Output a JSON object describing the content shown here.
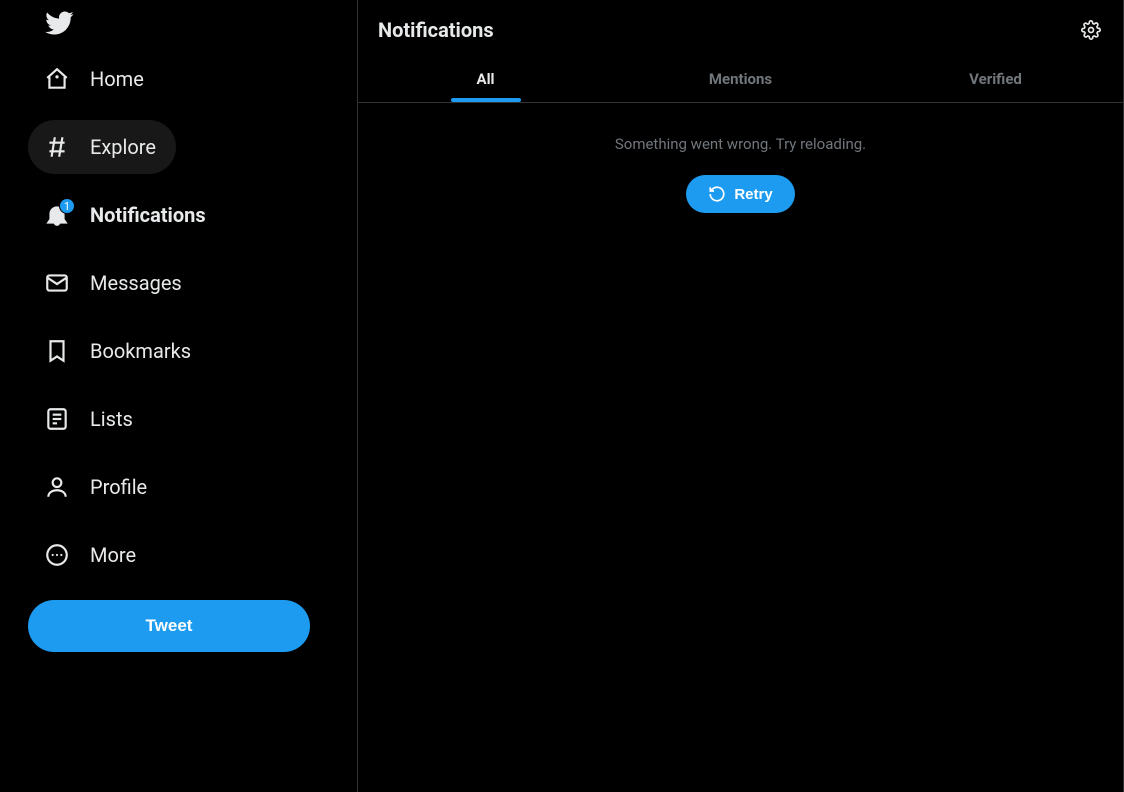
{
  "sidebar": {
    "tweet_label": "Tweet",
    "items": [
      {
        "key": "home",
        "label": "Home",
        "hovered": false,
        "active": false,
        "badge": null
      },
      {
        "key": "explore",
        "label": "Explore",
        "hovered": true,
        "active": false,
        "badge": null
      },
      {
        "key": "notifications",
        "label": "Notifications",
        "hovered": false,
        "active": true,
        "badge": "1"
      },
      {
        "key": "messages",
        "label": "Messages",
        "hovered": false,
        "active": false,
        "badge": null
      },
      {
        "key": "bookmarks",
        "label": "Bookmarks",
        "hovered": false,
        "active": false,
        "badge": null
      },
      {
        "key": "lists",
        "label": "Lists",
        "hovered": false,
        "active": false,
        "badge": null
      },
      {
        "key": "profile",
        "label": "Profile",
        "hovered": false,
        "active": false,
        "badge": null
      },
      {
        "key": "more",
        "label": "More",
        "hovered": false,
        "active": false,
        "badge": null
      }
    ]
  },
  "header": {
    "title": "Notifications"
  },
  "tabs": [
    {
      "key": "all",
      "label": "All",
      "active": true
    },
    {
      "key": "mentions",
      "label": "Mentions",
      "active": false
    },
    {
      "key": "verified",
      "label": "Verified",
      "active": false
    }
  ],
  "content": {
    "error_message": "Something went wrong. Try reloading.",
    "retry_label": "Retry"
  },
  "colors": {
    "accent": "#1d9bf0"
  }
}
